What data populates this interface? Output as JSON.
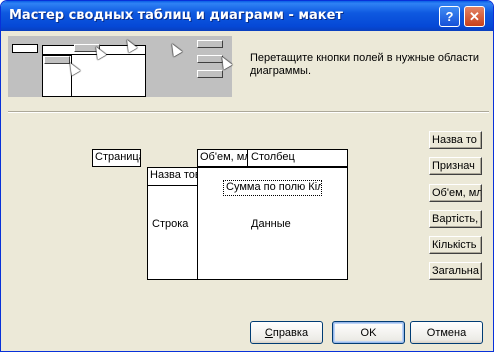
{
  "window": {
    "title": "Мастер сводных таблиц и диаграмм - макет",
    "help_label": "?",
    "close_label": "✕"
  },
  "instruction": "Перетащите кнопки полей в нужные области диаграммы.",
  "layout": {
    "page_label": "Страница",
    "column_fields": [
      "Об'ем, мл",
      "Столбец"
    ],
    "row_field": "Назва тов",
    "row_label": "Строка",
    "data_field": "Сумма по полю Кіл",
    "data_label": "Данные"
  },
  "fields": [
    "Назва то",
    "Признач",
    "Об'ем, мл",
    "Вартість,",
    "Кількість",
    "Загальна"
  ],
  "buttons": {
    "help": {
      "prefix": "",
      "accel": "С",
      "rest": "правка"
    },
    "ok": "OK",
    "cancel": "Отмена"
  }
}
